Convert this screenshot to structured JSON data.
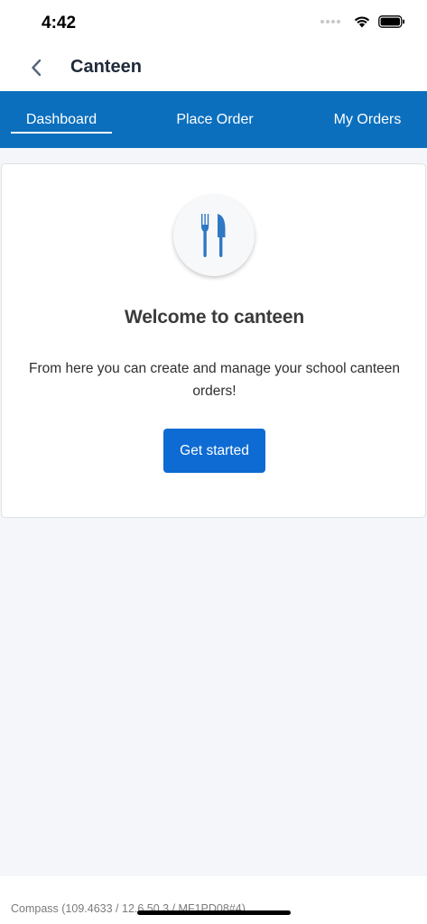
{
  "status_bar": {
    "time": "4:42"
  },
  "nav": {
    "back_icon": "chevron-left-icon",
    "title": "Canteen"
  },
  "tabs": [
    {
      "label": "Dashboard",
      "active": true
    },
    {
      "label": "Place Order",
      "active": false
    },
    {
      "label": "My Orders",
      "active": false
    }
  ],
  "welcome": {
    "icon": "cutlery-icon",
    "title": "Welcome to canteen",
    "description": "From here you can create and manage your school canteen orders!",
    "button_label": "Get started"
  },
  "footer": {
    "version_text": "Compass (109.4633 / 12.6.50.3 / MF1PD08#4)"
  },
  "colors": {
    "tab_bar": "#0b6fbe",
    "primary_button": "#0e6bd3",
    "icon": "#2f78c4",
    "background": "#f4f6f9"
  }
}
